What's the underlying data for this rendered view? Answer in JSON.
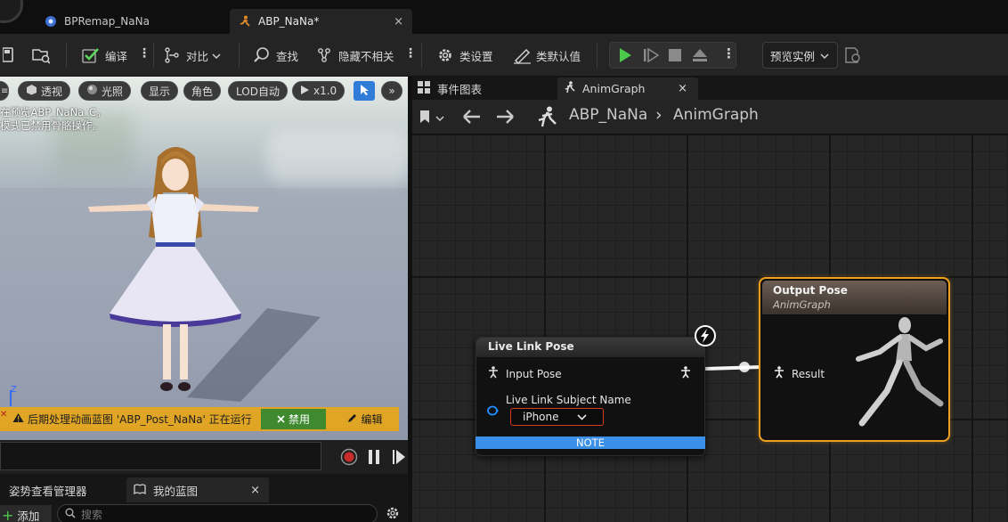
{
  "tabs": [
    {
      "label": "BPRemap_NaNa",
      "icon": "blueprint-icon"
    },
    {
      "label": "ABP_NaNa*",
      "icon": "anim-blueprint-icon",
      "close": "×"
    }
  ],
  "toolbar": {
    "compile": "编译",
    "diff": "对比",
    "find": "查找",
    "hide_unrelated": "隐藏不相关",
    "class_settings": "类设置",
    "class_defaults": "类默认值",
    "preview_instance": "预览实例",
    "more": "⋮",
    "dropdown": "⌄"
  },
  "viewport": {
    "toolbar": {
      "perspective": "透视",
      "lit": "光照",
      "show": "显示",
      "character": "角色",
      "lod": "LOD自动",
      "speed": "x1.0",
      "overflow": "»"
    },
    "message_line1": "在预览ABP_NaNa_C。",
    "message_line2": "模式已禁用骨骼操作。",
    "axis_label": "Z",
    "warning_text": "后期处理动画蓝图 'ABP_Post_NaNa' 正在运行",
    "warning_disable": "禁用",
    "warning_edit": "编辑"
  },
  "lower_tabs": {
    "pose_watch": "姿势查看管理器",
    "my_blueprint": "我的蓝图",
    "close": "×",
    "add": "添加",
    "search_placeholder": "搜索"
  },
  "graph": {
    "tab_event_graph": "事件图表",
    "tab_anim_graph": "AnimGraph",
    "tab_close": "×",
    "breadcrumb_root": "ABP_NaNa",
    "breadcrumb_sep": "›",
    "breadcrumb_current": "AnimGraph",
    "live_link_node": {
      "title": "Live Link Pose",
      "input_pose": "Input Pose",
      "subject_name_label": "Live Link Subject Name",
      "subject_name_value": "iPhone",
      "note": "NOTE"
    },
    "output_node": {
      "title": "Output Pose",
      "subtitle": "AnimGraph",
      "result": "Result"
    }
  },
  "colors": {
    "accent_orange": "#f0a020",
    "note_blue": "#3a8fe8",
    "play_green": "#4cc94c",
    "warning_yellow": "#e0a524",
    "disable_green": "#3f8a2f",
    "dropdown_border": "#d83a22"
  }
}
